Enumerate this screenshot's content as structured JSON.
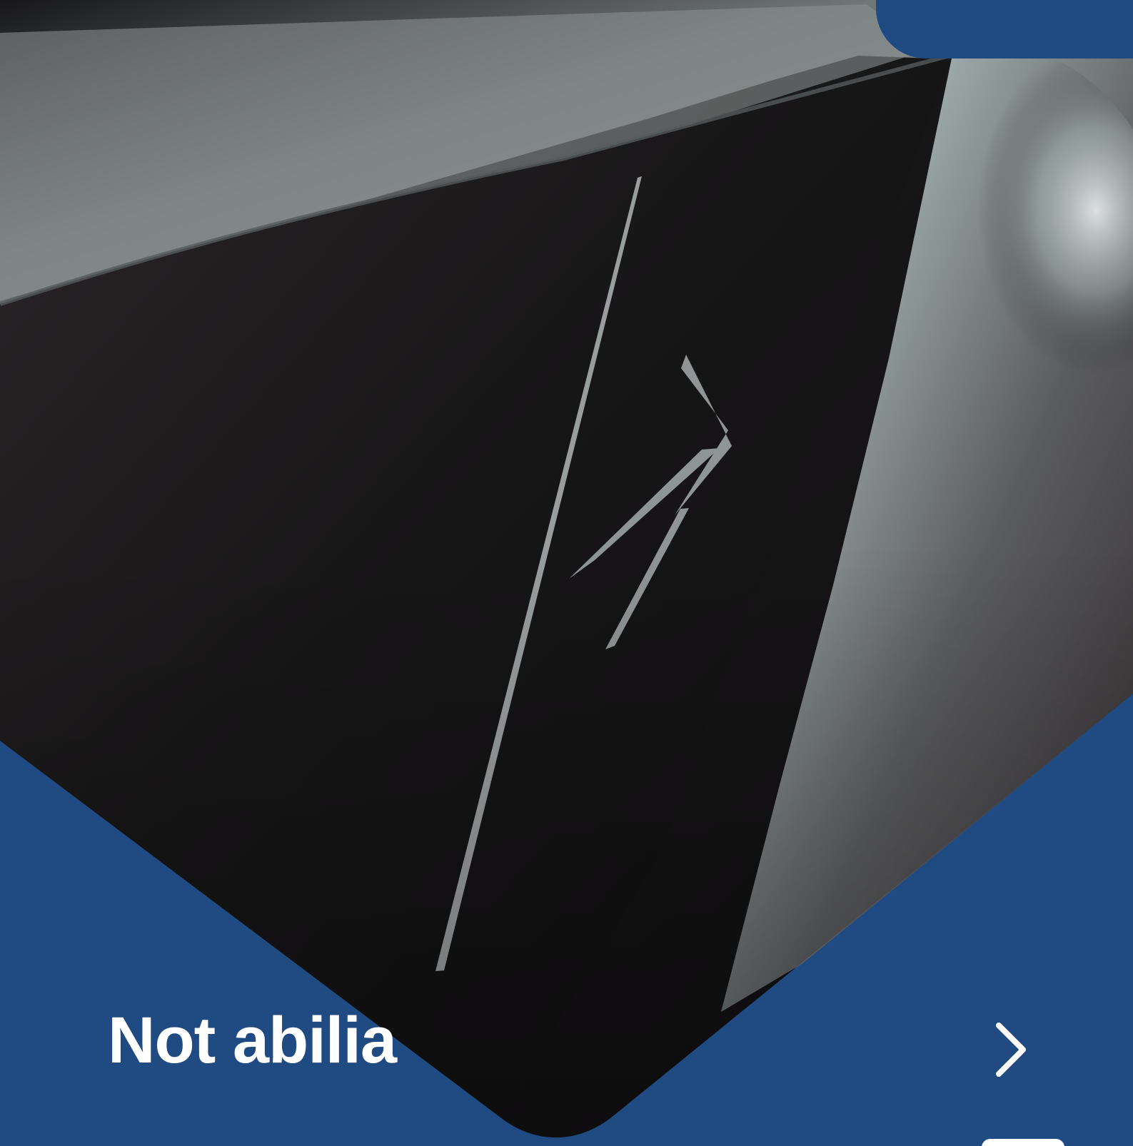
{
  "card": {
    "title": "Not abilia",
    "accent_color": "#1f4a82",
    "text_color": "#ffffff"
  },
  "navigation": {
    "next_icon": "chevron-right-icon"
  }
}
